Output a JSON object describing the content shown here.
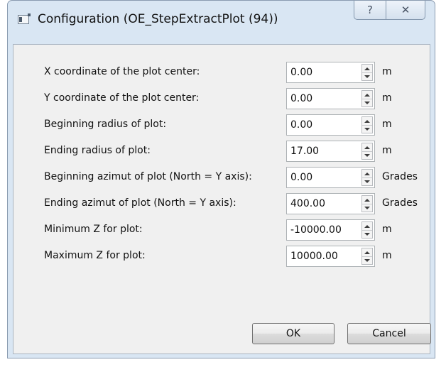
{
  "window": {
    "title": "Configuration (OE_StepExtractPlot (94))",
    "help_glyph": "?",
    "close_glyph": "✕"
  },
  "fields": [
    {
      "label": "X coordinate of the plot center:",
      "value": "0.00",
      "unit": "m"
    },
    {
      "label": "Y coordinate of the plot center:",
      "value": "0.00",
      "unit": "m"
    },
    {
      "label": "Beginning radius of plot:",
      "value": "0.00",
      "unit": "m"
    },
    {
      "label": "Ending radius of plot:",
      "value": "17.00",
      "unit": "m"
    },
    {
      "label": "Beginning azimut of plot (North = Y axis):",
      "value": "0.00",
      "unit": "Grades"
    },
    {
      "label": "Ending azimut of plot (North = Y axis):",
      "value": "400.00",
      "unit": "Grades"
    },
    {
      "label": "Minimum Z for plot:",
      "value": "-10000.00",
      "unit": "m"
    },
    {
      "label": "Maximum Z for plot:",
      "value": "10000.00",
      "unit": "m"
    }
  ],
  "buttons": {
    "ok_label": "OK",
    "cancel_label": "Cancel"
  }
}
